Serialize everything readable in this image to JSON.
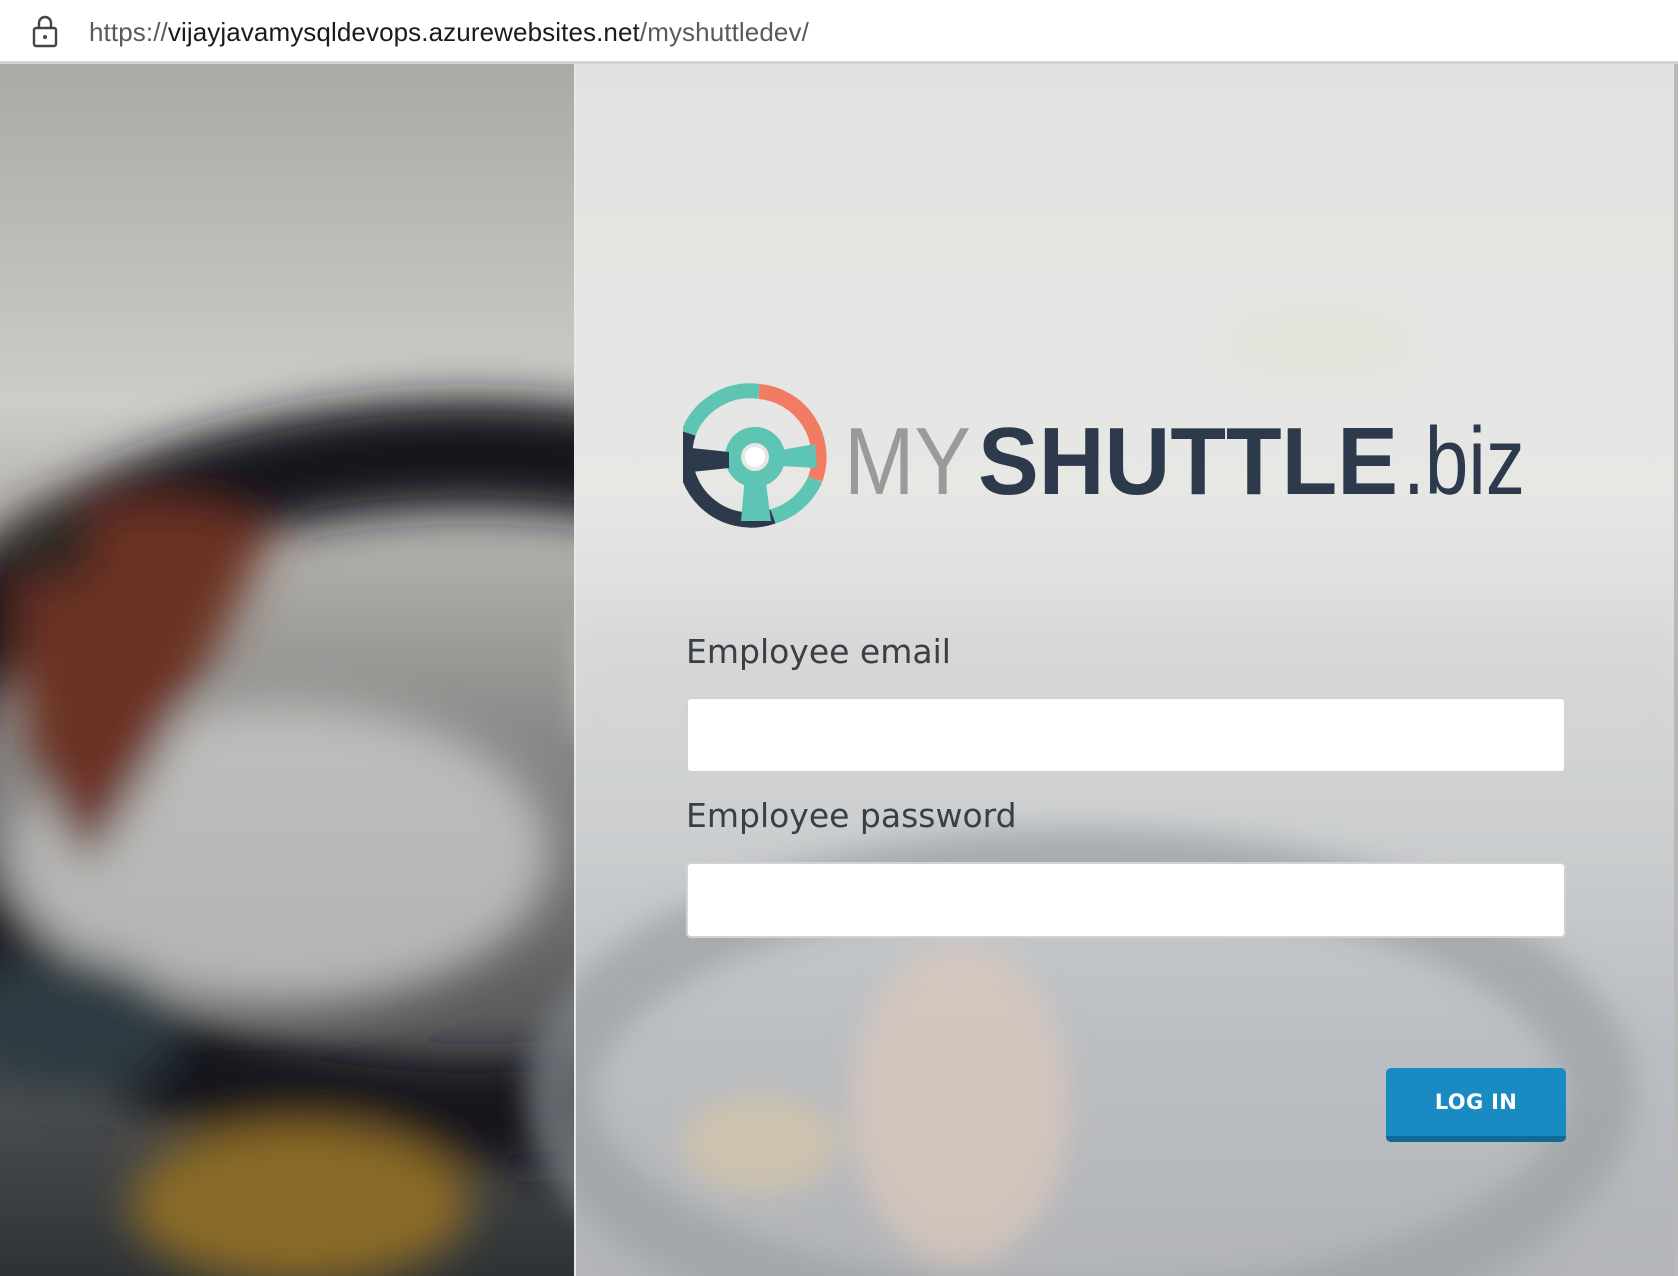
{
  "browser": {
    "url_scheme": "https://",
    "url_host": "vijayjavamysqldevops.azurewebsites.net",
    "url_path": "/myshuttledev/"
  },
  "logo": {
    "brand_my": "MY",
    "brand_shuttle": "SHUTTLE",
    "brand_tld": ".biz",
    "colors": {
      "teal": "#5ec4b4",
      "coral": "#f27c63",
      "navy": "#2c3a4c",
      "gray": "#9a9a9a"
    }
  },
  "form": {
    "email_label": "Employee email",
    "email_value": "",
    "password_label": "Employee password",
    "password_value": "",
    "login_label": "LOG IN"
  },
  "colors": {
    "button": "#1a8ac2",
    "button_shadow": "#116994"
  }
}
